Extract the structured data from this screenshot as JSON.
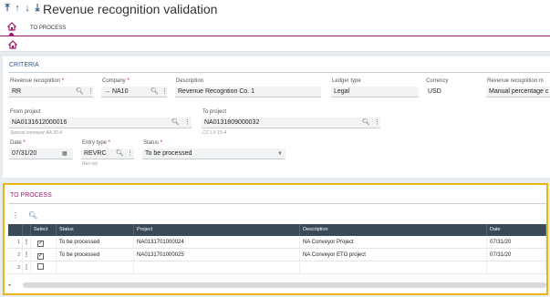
{
  "header": {
    "title": "Revenue recognition validation",
    "arrows": [
      "⤒",
      "↑",
      "↓",
      "⤓"
    ]
  },
  "tabs": {
    "active_label": "TO PROCESS"
  },
  "criteria": {
    "title": "CRITERIA",
    "revenue_recognition": {
      "label": "Revenue recognition",
      "value": "RR"
    },
    "company": {
      "label": "Company",
      "value": "NA10",
      "prefix": "→"
    },
    "description": {
      "label": "Description",
      "value": "Revenue Recogntion Co. 1"
    },
    "ledger_type": {
      "label": "Ledger type",
      "value": "Legal"
    },
    "currency": {
      "label": "Currency",
      "value": "USD"
    },
    "revenue_method": {
      "label": "Revenue recognition m",
      "value": "Manual percentage c"
    },
    "from_project": {
      "label": "From project",
      "value": "NA0131612000016",
      "sub": "Special conveyor AA 30.4"
    },
    "to_project": {
      "label": "To project",
      "value": "NA0131809000032",
      "sub": "CC LX 15-4"
    },
    "date": {
      "label": "Date",
      "value": "07/31/20"
    },
    "entry_type": {
      "label": "Entry type",
      "value": "REVRC",
      "sub": "Rev rec"
    },
    "status": {
      "label": "Status",
      "value": "To be processed"
    }
  },
  "process": {
    "title": "TO PROCESS",
    "columns": {
      "select": "Select",
      "status": "Status",
      "project": "Project",
      "description": "Description",
      "date": "Date"
    },
    "rows": [
      {
        "num": "1",
        "checked": true,
        "status": "To be processed",
        "project": "NA0131701000024",
        "description": "NA Conveyor Project",
        "date": "07/31/20"
      },
      {
        "num": "2",
        "checked": true,
        "status": "To be processed",
        "project": "NA0131701000025",
        "description": "NA Conveyor ETO project",
        "date": "07/31/20"
      },
      {
        "num": "3",
        "checked": false,
        "status": "",
        "project": "",
        "description": "",
        "date": ""
      }
    ]
  },
  "colors": {
    "accent": "#9b1b6c",
    "highlight_border": "#e8b417",
    "grid_header": "#3a4a57",
    "criteria_title": "#2b5a8a"
  }
}
